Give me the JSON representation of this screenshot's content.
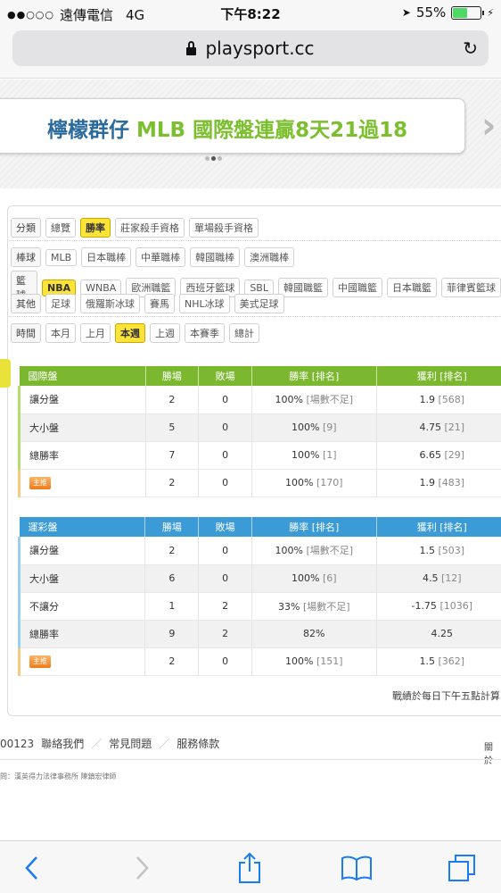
{
  "status_bar": {
    "carrier": "遠傳電信",
    "network": "4G",
    "time": "下午8:22",
    "battery": "55%",
    "battery_level": 0.55
  },
  "browser": {
    "url": "playsport.cc"
  },
  "banner": {
    "name": "檸檬群仔",
    "headline": "MLB 國際盤連贏8天21過18"
  },
  "filters": {
    "category": {
      "label": "分類",
      "options": [
        "總覽",
        "勝率",
        "莊家殺手資格",
        "單場殺手資格"
      ],
      "active": 1
    },
    "baseball": {
      "label": "棒球",
      "options": [
        "MLB",
        "日本職棒",
        "中華職棒",
        "韓國職棒",
        "澳洲職棒"
      ]
    },
    "basketball": {
      "label": "籃球",
      "options": [
        "NBA",
        "WNBA",
        "歐洲職籃",
        "西班牙籃球",
        "SBL",
        "韓國職籃",
        "中國職籃",
        "日本職籃",
        "菲律賓籃球"
      ],
      "active": 0
    },
    "other": {
      "label": "其他",
      "options": [
        "足球",
        "俄羅斯冰球",
        "賽馬",
        "NHL冰球",
        "美式足球"
      ]
    },
    "time": {
      "label": "時間",
      "options": [
        "本月",
        "上月",
        "本週",
        "上週",
        "本賽季",
        "總計"
      ],
      "active": 2
    }
  },
  "international_table": {
    "headers": [
      "國際盤",
      "勝場",
      "敗場",
      "勝率 [排名]",
      "獲利 [排名]"
    ],
    "rows": [
      {
        "name": "讓分盤",
        "wins": "2",
        "losses": "0",
        "rate": "100%",
        "rate_rank": "[場數不足]",
        "profit": "1.9",
        "profit_rank": "[568]"
      },
      {
        "name": "大小盤",
        "wins": "5",
        "losses": "0",
        "rate": "100%",
        "rate_rank": "[9]",
        "profit": "4.75",
        "profit_rank": "[21]"
      },
      {
        "name": "總勝率",
        "wins": "7",
        "losses": "0",
        "rate": "100%",
        "rate_rank": "[1]",
        "profit": "6.65",
        "profit_rank": "[29]"
      },
      {
        "name": "主推",
        "wins": "2",
        "losses": "0",
        "rate": "100%",
        "rate_rank": "[170]",
        "profit": "1.9",
        "profit_rank": "[483]"
      }
    ]
  },
  "lottery_table": {
    "headers": [
      "運彩盤",
      "勝場",
      "敗場",
      "勝率 [排名]",
      "獲利 [排名]"
    ],
    "rows": [
      {
        "name": "讓分盤",
        "wins": "2",
        "losses": "0",
        "rate": "100%",
        "rate_rank": "[場數不足]",
        "profit": "1.5",
        "profit_rank": "[503]"
      },
      {
        "name": "大小盤",
        "wins": "6",
        "losses": "0",
        "rate": "100%",
        "rate_rank": "[6]",
        "profit": "4.5",
        "profit_rank": "[12]"
      },
      {
        "name": "不讓分",
        "wins": "1",
        "losses": "2",
        "rate": "33%",
        "rate_rank": "[場數不足]",
        "profit": "-1.75",
        "profit_rank": "[1036]"
      },
      {
        "name": "總勝率",
        "wins": "9",
        "losses": "2",
        "rate": "82%",
        "rate_rank": "",
        "profit": "4.25",
        "profit_rank": ""
      },
      {
        "name": "主推",
        "wins": "2",
        "losses": "0",
        "rate": "100%",
        "rate_rank": "[151]",
        "profit": "1.5",
        "profit_rank": "[362]"
      }
    ]
  },
  "footnote": "戰績於每日下午五點計算",
  "footer": {
    "phone_tail": "00123",
    "links": [
      "聯絡我們",
      "常見問題",
      "服務條款"
    ],
    "right_text": "關於",
    "legal": "問：漢英得力法律事務所 陳鎮宏律師"
  },
  "colors": {
    "international_header": "#7cb82f",
    "lottery_header": "#3b9bd6",
    "active_chip": "#fbe337"
  }
}
